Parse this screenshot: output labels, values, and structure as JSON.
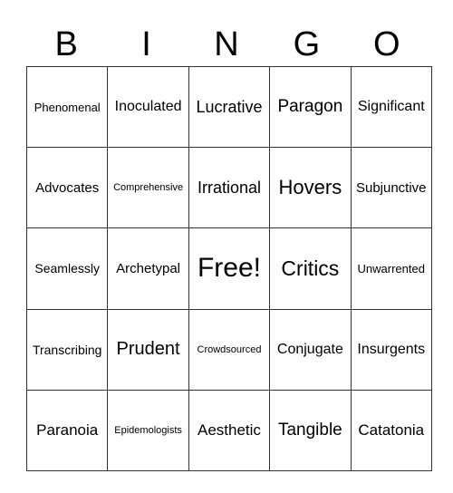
{
  "header": {
    "letters": [
      "B",
      "I",
      "N",
      "G",
      "O"
    ]
  },
  "board": {
    "rows": [
      [
        "Phenomenal",
        "Inoculated",
        "Lucrative",
        "Paragon",
        "Significant"
      ],
      [
        "Advocates",
        "Comprehensive",
        "Irrational",
        "Hovers",
        "Subjunctive"
      ],
      [
        "Seamlessly",
        "Archetypal",
        "Free!",
        "Critics",
        "Unwarrented"
      ],
      [
        "Transcribing",
        "Prudent",
        "Crowdsourced",
        "Conjugate",
        "Insurgents"
      ],
      [
        "Paranoia",
        "Epidemologists",
        "Aesthetic",
        "Tangible",
        "Catatonia"
      ]
    ]
  }
}
